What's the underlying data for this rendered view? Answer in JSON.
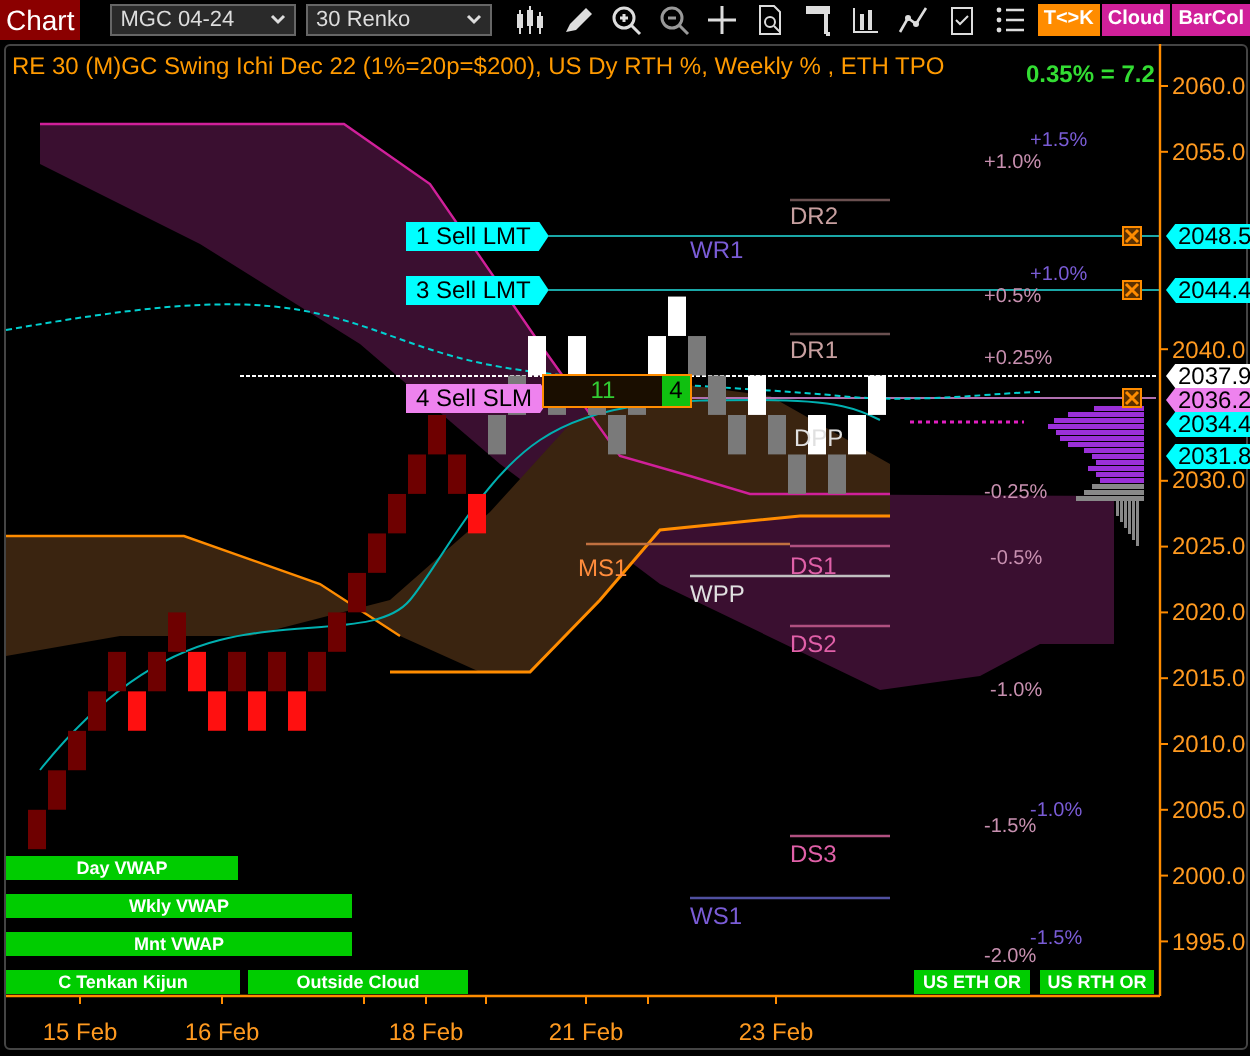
{
  "toolbar": {
    "title": "Chart",
    "instrument": "MGC 04-24",
    "bar_type": "30 Renko",
    "buttons": [
      {
        "label": "T<>K",
        "color": "#ff8c00"
      },
      {
        "label": "Cloud",
        "color": "#d0209a"
      },
      {
        "label": "BarCol",
        "color": "#d0209a"
      }
    ]
  },
  "chart": {
    "title": "RE 30 (M)GC Swing Ichi Dec 22 (1%=20p=$200), US Dy RTH %, Weekly % , ETH TPO",
    "change": "0.35% = 7.2",
    "price_axis": [
      "2060.0",
      "2055.0",
      "2040.0",
      "2030.0",
      "2025.0",
      "2020.0",
      "2015.0",
      "2010.0",
      "2005.0",
      "2000.0",
      "1995.0"
    ],
    "price_tags": [
      {
        "label": "2048.5",
        "color": "#00ffff"
      },
      {
        "label": "2044.4",
        "color": "#00ffff"
      },
      {
        "label": "2037.9",
        "color": "#ffffff"
      },
      {
        "label": "2036.2",
        "color": "#ee82ee"
      },
      {
        "label": "2034.4",
        "color": "#00ffff"
      },
      {
        "label": "2031.8",
        "color": "#00ffff"
      }
    ],
    "orders": [
      {
        "label": "1 Sell LMT",
        "color": "#00ffff"
      },
      {
        "label": "3 Sell LMT",
        "color": "#00ffff"
      },
      {
        "label": "4 Sell SLM",
        "color": "#ee82ee"
      }
    ],
    "position": {
      "quantity": "11",
      "ticks": "4"
    },
    "pivots": [
      {
        "label": "DR2",
        "color": "#c8a0a0"
      },
      {
        "label": "WR1",
        "color": "#7a5cd6"
      },
      {
        "label": "DR1",
        "color": "#c8a0a0"
      },
      {
        "label": "DPP",
        "color": "#e0e0e0"
      },
      {
        "label": "MS1",
        "color": "#ff8c3c"
      },
      {
        "label": "WPP",
        "color": "#e0e0e0"
      },
      {
        "label": "DS1",
        "color": "#e060a8"
      },
      {
        "label": "DS2",
        "color": "#e060a8"
      },
      {
        "label": "DS3",
        "color": "#e060a8"
      },
      {
        "label": "WS1",
        "color": "#7a5cd6"
      }
    ],
    "percent_levels": [
      {
        "label": "+1.5%",
        "color": "#7a5cd6"
      },
      {
        "label": "+1.0%",
        "color": "#c890b0"
      },
      {
        "label": "+1.0%",
        "color": "#7a5cd6"
      },
      {
        "label": "+0.5%",
        "color": "#c890b0"
      },
      {
        "label": "+0.25%",
        "color": "#c890b0"
      },
      {
        "label": "-0.25%",
        "color": "#c890b0"
      },
      {
        "label": "-0.5%",
        "color": "#c890b0"
      },
      {
        "label": "-1.0%",
        "color": "#c890b0"
      },
      {
        "label": "-1.0%",
        "color": "#7a5cd6"
      },
      {
        "label": "-1.5%",
        "color": "#c890b0"
      },
      {
        "label": "-1.5%",
        "color": "#7a5cd6"
      },
      {
        "label": "-2.0%",
        "color": "#c890b0"
      }
    ],
    "indicator_bars": [
      "Day VWAP",
      "Wkly VWAP",
      "Mnt VWAP",
      "C Tenkan Kijun",
      "Outside Cloud",
      "US ETH OR",
      "US RTH OR"
    ],
    "date_axis": [
      "15 Feb",
      "16 Feb",
      "18 Feb",
      "21 Feb",
      "23 Feb"
    ]
  }
}
